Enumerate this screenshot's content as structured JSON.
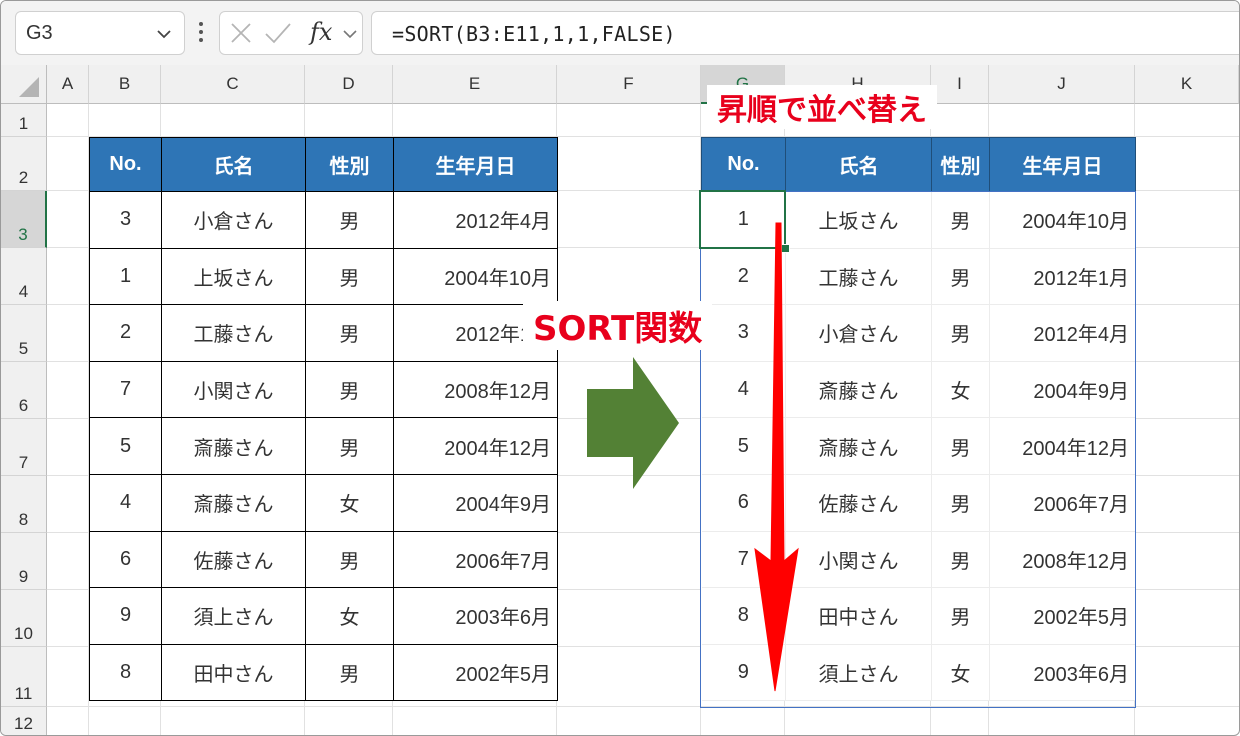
{
  "name_box": {
    "value": "G3"
  },
  "formula_bar": {
    "fx_label": "fx",
    "formula": "=SORT(B3:E11,1,1,FALSE)"
  },
  "column_headers": [
    "A",
    "B",
    "C",
    "D",
    "E",
    "F",
    "G",
    "H",
    "I",
    "J",
    "K"
  ],
  "selected_column": "G",
  "row_headers": [
    "1",
    "2",
    "3",
    "4",
    "5",
    "6",
    "7",
    "8",
    "9",
    "10",
    "11",
    "12"
  ],
  "selected_row": "3",
  "source_table": {
    "headers": [
      "No.",
      "氏名",
      "性別",
      "生年月日"
    ],
    "rows": [
      [
        "3",
        "小倉さん",
        "男",
        "2012年4月"
      ],
      [
        "1",
        "上坂さん",
        "男",
        "2004年10月"
      ],
      [
        "2",
        "工藤さん",
        "男",
        "2012年1月"
      ],
      [
        "7",
        "小関さん",
        "男",
        "2008年12月"
      ],
      [
        "5",
        "斎藤さん",
        "男",
        "2004年12月"
      ],
      [
        "4",
        "斎藤さん",
        "女",
        "2004年9月"
      ],
      [
        "6",
        "佐藤さん",
        "男",
        "2006年7月"
      ],
      [
        "9",
        "須上さん",
        "女",
        "2003年6月"
      ],
      [
        "8",
        "田中さん",
        "男",
        "2002年5月"
      ]
    ]
  },
  "sorted_table": {
    "headers": [
      "No.",
      "氏名",
      "性別",
      "生年月日"
    ],
    "rows": [
      [
        "1",
        "上坂さん",
        "男",
        "2004年10月"
      ],
      [
        "2",
        "工藤さん",
        "男",
        "2012年1月"
      ],
      [
        "3",
        "小倉さん",
        "男",
        "2012年4月"
      ],
      [
        "4",
        "斎藤さん",
        "女",
        "2004年9月"
      ],
      [
        "5",
        "斎藤さん",
        "男",
        "2004年12月"
      ],
      [
        "6",
        "佐藤さん",
        "男",
        "2006年7月"
      ],
      [
        "7",
        "小関さん",
        "男",
        "2008年12月"
      ],
      [
        "8",
        "田中さん",
        "男",
        "2002年5月"
      ],
      [
        "9",
        "須上さん",
        "女",
        "2003年6月"
      ]
    ]
  },
  "annotations": {
    "sort_function_label": "SORT関数",
    "ascending_label": "昇順で並べ替え"
  },
  "colors": {
    "header_fill": "#2e75b6",
    "arrow_green": "#538135",
    "annotation_red": "#e8001c",
    "selection_green": "#217346"
  }
}
